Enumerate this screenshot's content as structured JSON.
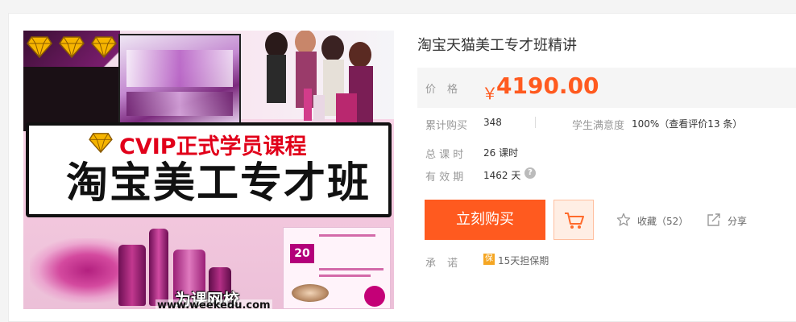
{
  "product": {
    "title": "淘宝天猫美工专才班精讲",
    "image": {
      "banner_subtitle": "CVIP正式学员课程",
      "banner_title": "淘宝美工专才班",
      "logo_text": "为课网校",
      "logo_url": "www.weekedu.com"
    }
  },
  "price": {
    "label": "价格",
    "currency": "￥",
    "value": "4190.00",
    "color": "#ff5a1f"
  },
  "stats": {
    "purchases_label": "累计购买",
    "purchases_value": "348",
    "satisfaction_label": "学生满意度",
    "satisfaction_value": "100%（查看评价13 条）",
    "hours_label": "总 课 时",
    "hours_value": "26 课时",
    "validity_label": "有 效 期",
    "validity_value": "1462 天"
  },
  "actions": {
    "buy_label": "立刻购买",
    "favorite_label": "收藏（52）",
    "share_label": "分享"
  },
  "promise": {
    "label": "承诺",
    "badge": "保",
    "text": "15天担保期"
  },
  "icons": {
    "cart": "shopping-cart-icon",
    "favorite": "star-icon",
    "share": "share-icon",
    "help": "question-icon",
    "diamond": "diamond-icon"
  }
}
